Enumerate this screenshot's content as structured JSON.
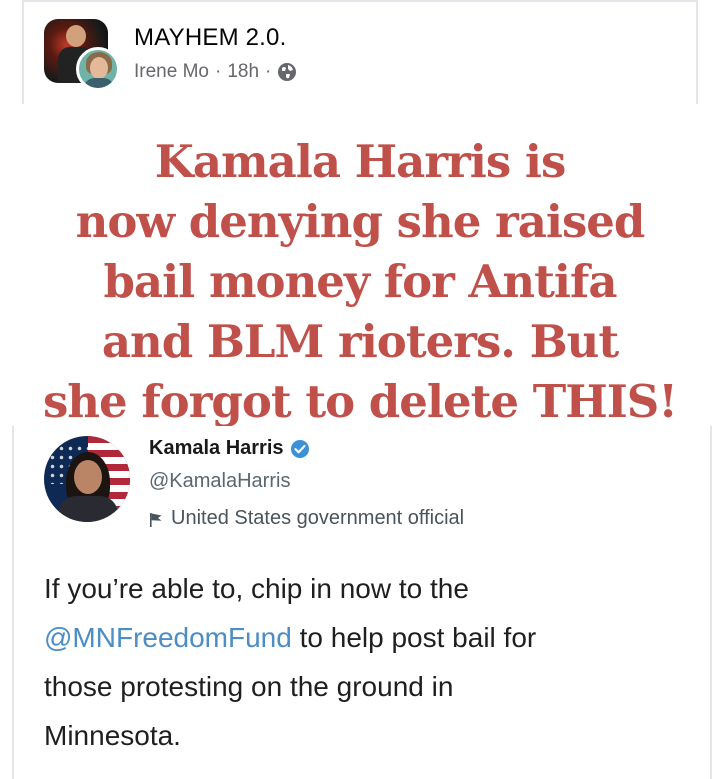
{
  "post": {
    "group_name": "MAYHEM 2.0.",
    "author": "Irene Mo",
    "separator": "·",
    "time": "18h",
    "privacy_icon": "globe-icon"
  },
  "meme": {
    "headline_lines": [
      "Kamala Harris is",
      "now denying she raised",
      "bail money for Antifa",
      "and BLM rioters. But",
      "she forgot to delete THIS!"
    ],
    "headline_color": "#c0504a",
    "tweet": {
      "name": "Kamala Harris",
      "verified_icon": "verified-badge-icon",
      "handle": "@KamalaHarris",
      "label": "United States government official",
      "label_icon": "flag-icon",
      "body_before": "If you’re able to, chip in now to the",
      "mention": "@MNFreedomFund",
      "body_after": " to help post bail for",
      "body_line3": "those protesting on the ground in",
      "body_line4": "Minnesota.",
      "mention_color": "#4b8dc4"
    }
  }
}
